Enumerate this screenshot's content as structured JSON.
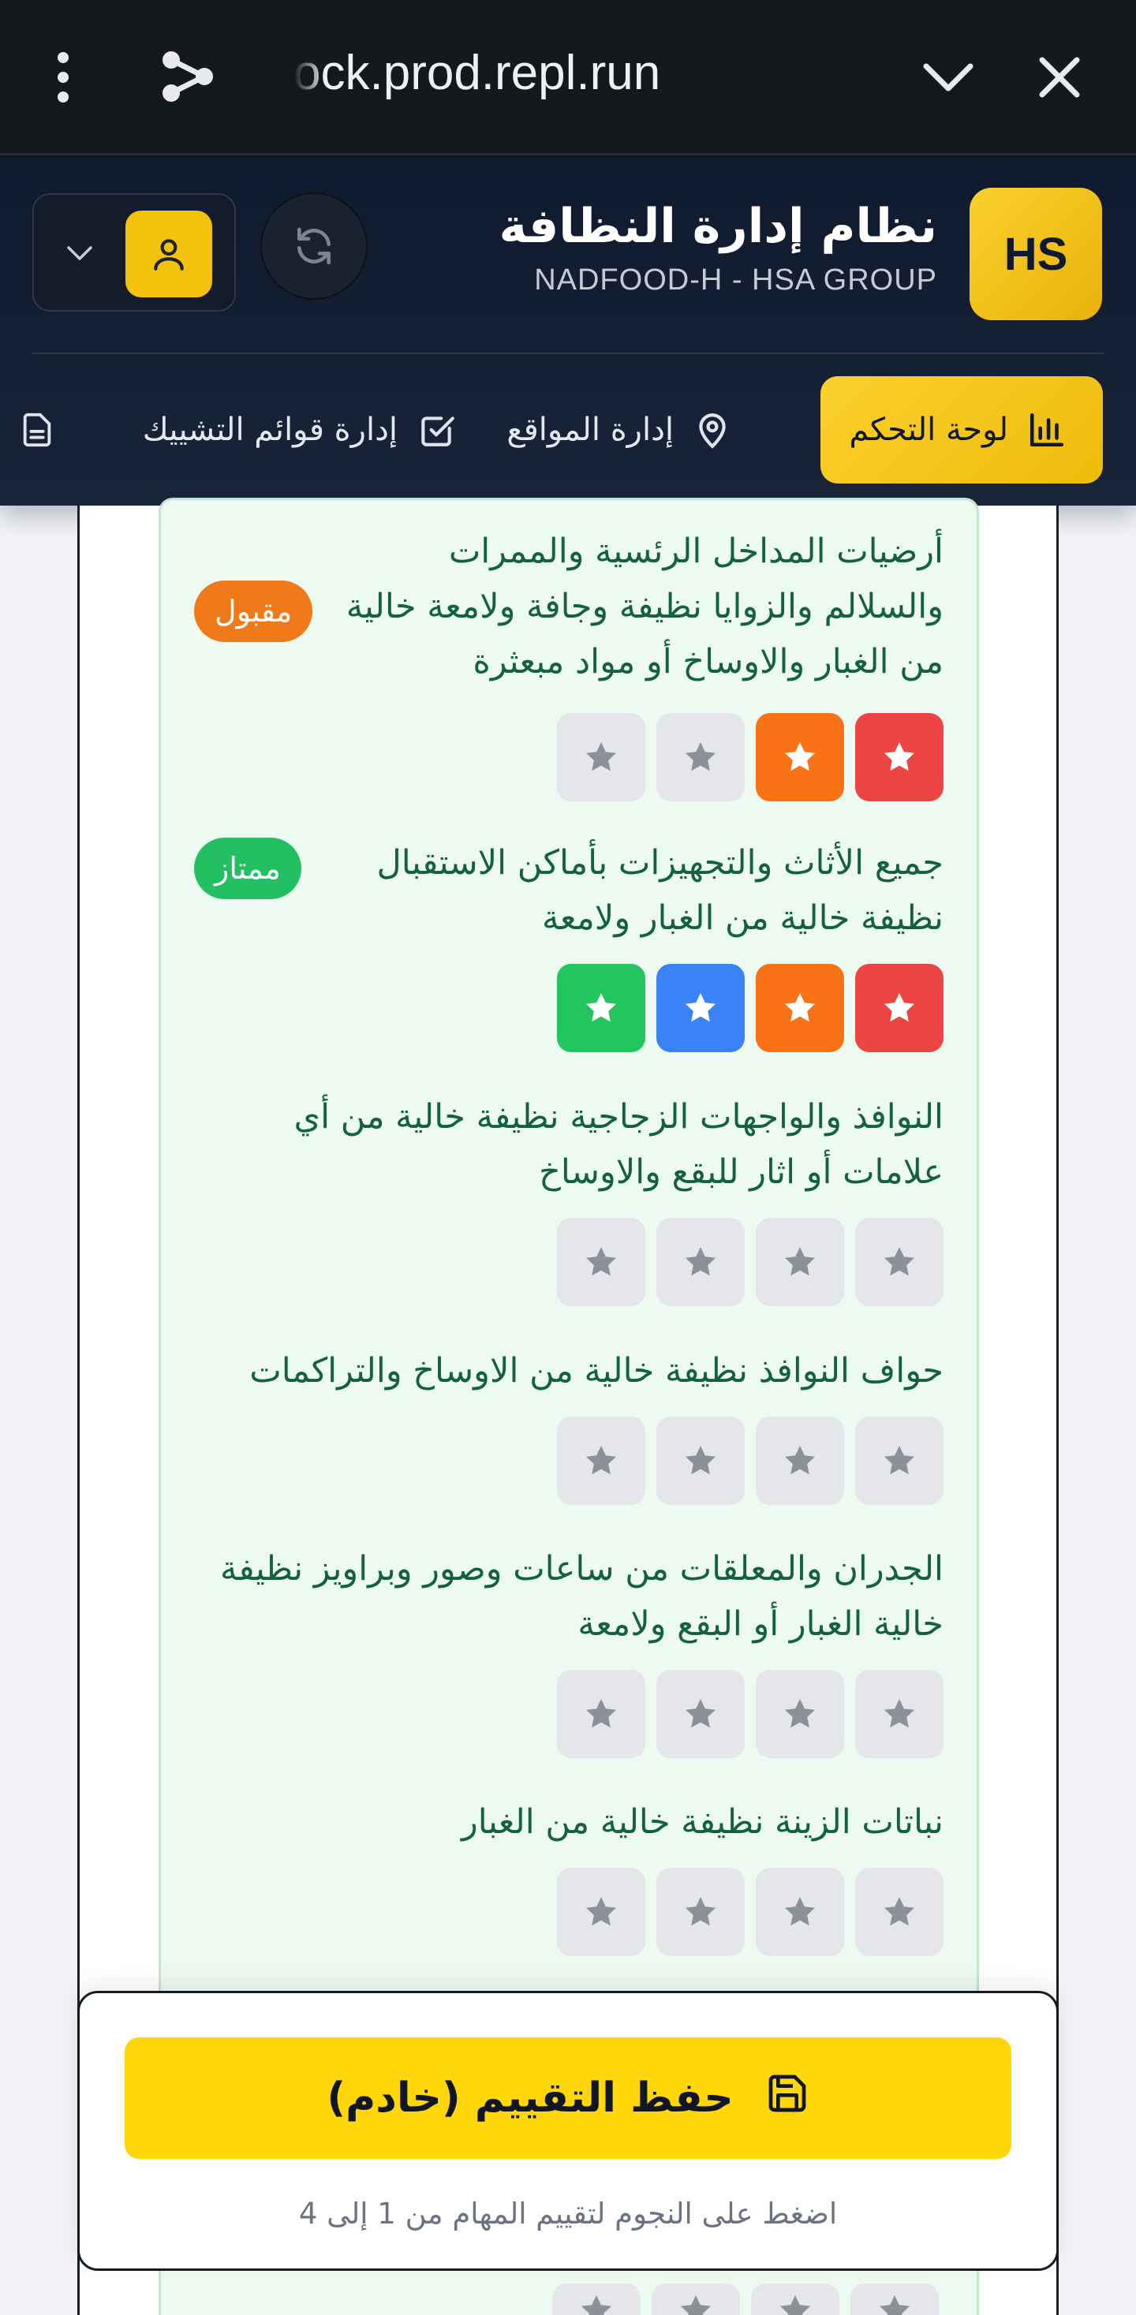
{
  "browser": {
    "url": "ock.prod.repl.run"
  },
  "header": {
    "logo_text": "HS",
    "title": "نظام إدارة النظافة",
    "subtitle": "NADFOOD-H - HSA GROUP"
  },
  "nav": {
    "items": [
      {
        "label": "لوحة التحكم",
        "icon": "bar-chart-icon",
        "active": true
      },
      {
        "label": "إدارة المواقع",
        "icon": "map-pin-icon",
        "active": false
      },
      {
        "label": "إدارة قوائم التشييك",
        "icon": "checkbox-icon",
        "active": false
      },
      {
        "label": "",
        "icon": "document-icon",
        "active": false
      }
    ]
  },
  "tasks": [
    {
      "text": "أرضيات المداخل الرئسية والممرات والسلالم والزوايا نظيفة وجافة ولامعة خالية من الغبار والاوساخ أو مواد مبعثرة",
      "badge": "مقبول",
      "rating": 2
    },
    {
      "text": "جميع الأثاث والتجهيزات بأماكن الاستقبال نظيفة خالية من الغبار ولامعة",
      "badge": "ممتاز",
      "rating": 4
    },
    {
      "text": "النوافذ والواجهات الزجاجية نظيفة خالية من أي علامات أو اثار للبقع والاوساخ",
      "badge": "",
      "rating": 0
    },
    {
      "text": "حواف النوافذ نظيفة خالية من الاوساخ والتراكمات",
      "badge": "",
      "rating": 0
    },
    {
      "text": "الجدران والمعلقات من ساعات وصور وبراويز نظيفة خالية الغبار أو البقع ولامعة",
      "badge": "",
      "rating": 0
    },
    {
      "text": "نباتات الزينة نظيفة خالية من الغبار",
      "badge": "",
      "rating": 0
    }
  ],
  "rating_colors": {
    "1": "#ef4444",
    "2": "#f97316",
    "3": "#3b82f6",
    "4": "#22c55e",
    "empty": "#e4e6ea"
  },
  "footer": {
    "save_label": "حفظ التقييم (خادم)",
    "hint": "اضغط على النجوم لتقييم المهام من 1 إلى 4"
  }
}
